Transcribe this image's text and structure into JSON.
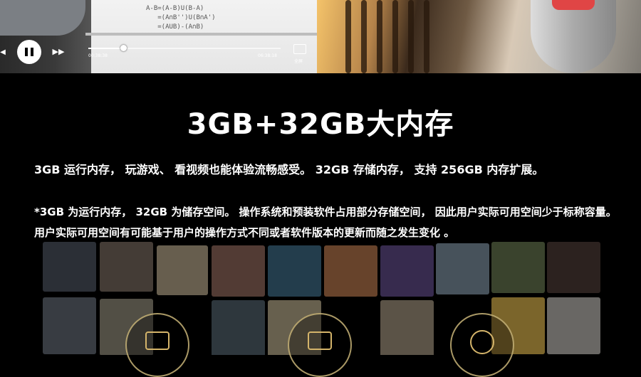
{
  "video": {
    "math_text": "A-B=(A-B)U(B-A)\n   =(A∩B'')U(B∩A')\n   =(AUB)-(A∩B)",
    "current_time": "00:38:38",
    "total_time": "06:38:18",
    "progress_fraction": 0.18,
    "fullscreen_label": "全屏"
  },
  "main": {
    "title": "3GB+32GB大内存",
    "paragraph1": "3GB 运行内存，  玩游戏、  看视频也能体验流畅感受。  32GB 存储内存，  支持 256GB 内存扩展。",
    "paragraph2": "*3GB 为运行内存，  32GB 为储存空间。  操作系统和预装软件占用部分存储空间，  因此用户实际可用空间少于标称容量。  用户实际可用空间有可能基于用户的操作方式不同或者软件版本的更新而随之发生变化 。"
  },
  "icons": [
    "gallery-icon",
    "video-icon",
    "music-icon"
  ]
}
